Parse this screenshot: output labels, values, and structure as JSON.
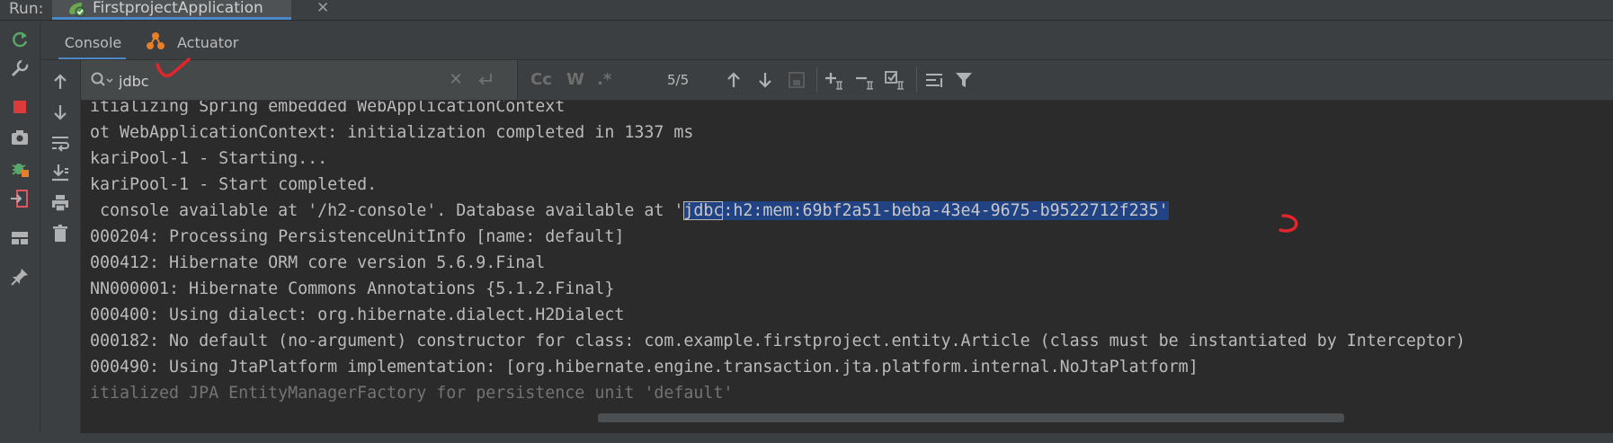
{
  "run_bar": {
    "label": "Run:",
    "tab_title": "FirstprojectApplication",
    "tab_close": "✕"
  },
  "sub_tabs": {
    "console": "Console",
    "actuator": "Actuator"
  },
  "search": {
    "query": "jdbc",
    "match_count": "5/5",
    "clear": "✕",
    "match_case": "Cc",
    "whole_words": "W",
    "regex": ".*"
  },
  "console": {
    "lines": [
      "itializing Spring embedded WebApplicationContext",
      "ot WebApplicationContext: initialization completed in 1337 ms",
      "kariPool-1 - Starting...",
      "kariPool-1 - Start completed.",
      " console available at '/h2-console'. Database available at '",
      "000204: Processing PersistenceUnitInfo [name: default]",
      "000412: Hibernate ORM core version 5.6.9.Final",
      "NN000001: Hibernate Commons Annotations {5.1.2.Final}",
      "000400: Using dialect: org.hibernate.dialect.H2Dialect",
      "000182: No default (no-argument) constructor for class: com.example.firstproject.entity.Article (class must be instantiated by Interceptor)",
      "000490: Using JtaPlatform implementation: [org.hibernate.engine.transaction.jta.platform.internal.NoJtaPlatform]",
      "itialized JPA EntityManagerFactory for persistence unit 'default'"
    ],
    "match_text": "jdbc",
    "match_rest": ":h2:mem:69bf2a51-beba-43e4-9675-b9522712f235'"
  },
  "colors": {
    "background": "#2b2b2b",
    "toolbar": "#3c3f41",
    "selection": "#214283",
    "accent": "#4a88c7",
    "annotation": "#e0252b"
  }
}
